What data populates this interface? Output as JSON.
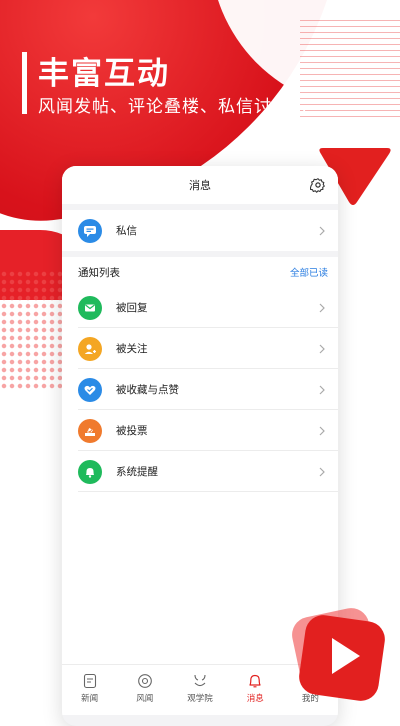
{
  "promo": {
    "headline": "丰富互动",
    "subline": "风闻发帖、评论叠楼、私信讨论…",
    "accent_color": "#e2201f"
  },
  "header": {
    "title": "消息",
    "settings_icon": "gear-icon"
  },
  "private_message": {
    "label": "私信",
    "icon": "chat-bubble-icon",
    "icon_color": "#2b8be6"
  },
  "notifications": {
    "title": "通知列表",
    "mark_all_read": "全部已读",
    "items": [
      {
        "label": "被回复",
        "icon": "envelope-icon",
        "icon_color": "#1fba5c"
      },
      {
        "label": "被关注",
        "icon": "user-add-icon",
        "icon_color": "#f4a623"
      },
      {
        "label": "被收藏与点赞",
        "icon": "heart-icon",
        "icon_color": "#2b8be6"
      },
      {
        "label": "被投票",
        "icon": "ballot-icon",
        "icon_color": "#f07a2d"
      },
      {
        "label": "系统提醒",
        "icon": "bell-icon",
        "icon_color": "#1fba5c"
      }
    ]
  },
  "tabbar": {
    "tabs": [
      {
        "label": "新闻",
        "icon": "news-icon"
      },
      {
        "label": "风闻",
        "icon": "disc-icon"
      },
      {
        "label": "观学院",
        "icon": "academy-icon"
      },
      {
        "label": "消息",
        "icon": "bell-icon",
        "active": true
      },
      {
        "label": "我的",
        "icon": "user-icon"
      }
    ]
  }
}
